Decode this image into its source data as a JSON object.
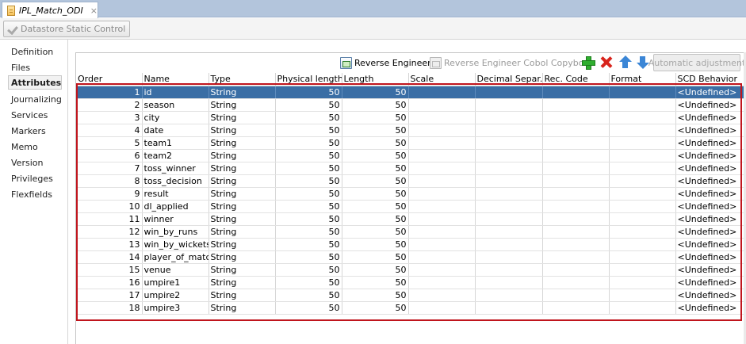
{
  "tab": {
    "title": "IPL_Match_ODI",
    "close": "×"
  },
  "toolbar": {
    "datastore_static_control": "Datastore Static Control"
  },
  "nav": {
    "items": [
      {
        "label": "Definition"
      },
      {
        "label": "Files"
      },
      {
        "label": "Attributes",
        "active": true
      },
      {
        "label": "Journalizing"
      },
      {
        "label": "Services"
      },
      {
        "label": "Markers"
      },
      {
        "label": "Memo"
      },
      {
        "label": "Version"
      },
      {
        "label": "Privileges"
      },
      {
        "label": "Flexfields"
      }
    ]
  },
  "grid_toolbar": {
    "reverse_engineer": "Reverse Engineer",
    "reverse_engineer_cobol": "Reverse Engineer Cobol Copybook",
    "add_icon": "plus-icon",
    "delete_icon": "delete-icon",
    "move_up_icon": "arrow-up-icon",
    "move_down_icon": "arrow-down-icon",
    "automatic_adjustment": "Automatic adjustment"
  },
  "table": {
    "columns": [
      "Order",
      "Name",
      "Type",
      "Physical length",
      "Length",
      "Scale",
      "Decimal Separ...",
      "Rec. Code",
      "Format",
      "SCD Behavior"
    ],
    "rows": [
      [
        "1",
        "id",
        "String",
        "50",
        "50",
        "",
        "",
        "",
        "",
        "<Undefined>"
      ],
      [
        "2",
        "season",
        "String",
        "50",
        "50",
        "",
        "",
        "",
        "",
        "<Undefined>"
      ],
      [
        "3",
        "city",
        "String",
        "50",
        "50",
        "",
        "",
        "",
        "",
        "<Undefined>"
      ],
      [
        "4",
        "date",
        "String",
        "50",
        "50",
        "",
        "",
        "",
        "",
        "<Undefined>"
      ],
      [
        "5",
        "team1",
        "String",
        "50",
        "50",
        "",
        "",
        "",
        "",
        "<Undefined>"
      ],
      [
        "6",
        "team2",
        "String",
        "50",
        "50",
        "",
        "",
        "",
        "",
        "<Undefined>"
      ],
      [
        "7",
        "toss_winner",
        "String",
        "50",
        "50",
        "",
        "",
        "",
        "",
        "<Undefined>"
      ],
      [
        "8",
        "toss_decision",
        "String",
        "50",
        "50",
        "",
        "",
        "",
        "",
        "<Undefined>"
      ],
      [
        "9",
        "result",
        "String",
        "50",
        "50",
        "",
        "",
        "",
        "",
        "<Undefined>"
      ],
      [
        "10",
        "dl_applied",
        "String",
        "50",
        "50",
        "",
        "",
        "",
        "",
        "<Undefined>"
      ],
      [
        "11",
        "winner",
        "String",
        "50",
        "50",
        "",
        "",
        "",
        "",
        "<Undefined>"
      ],
      [
        "12",
        "win_by_runs",
        "String",
        "50",
        "50",
        "",
        "",
        "",
        "",
        "<Undefined>"
      ],
      [
        "13",
        "win_by_wickets",
        "String",
        "50",
        "50",
        "",
        "",
        "",
        "",
        "<Undefined>"
      ],
      [
        "14",
        "player_of_match",
        "String",
        "50",
        "50",
        "",
        "",
        "",
        "",
        "<Undefined>"
      ],
      [
        "15",
        "venue",
        "String",
        "50",
        "50",
        "",
        "",
        "",
        "",
        "<Undefined>"
      ],
      [
        "16",
        "umpire1",
        "String",
        "50",
        "50",
        "",
        "",
        "",
        "",
        "<Undefined>"
      ],
      [
        "17",
        "umpire2",
        "String",
        "50",
        "50",
        "",
        "",
        "",
        "",
        "<Undefined>"
      ],
      [
        "18",
        "umpire3",
        "String",
        "50",
        "50",
        "",
        "",
        "",
        "",
        "<Undefined>"
      ]
    ],
    "selected_row": 0
  },
  "colors": {
    "selection": "#3a6ea5",
    "highlight_box": "#c0151d",
    "tab_strip": "#b3c5dc"
  }
}
